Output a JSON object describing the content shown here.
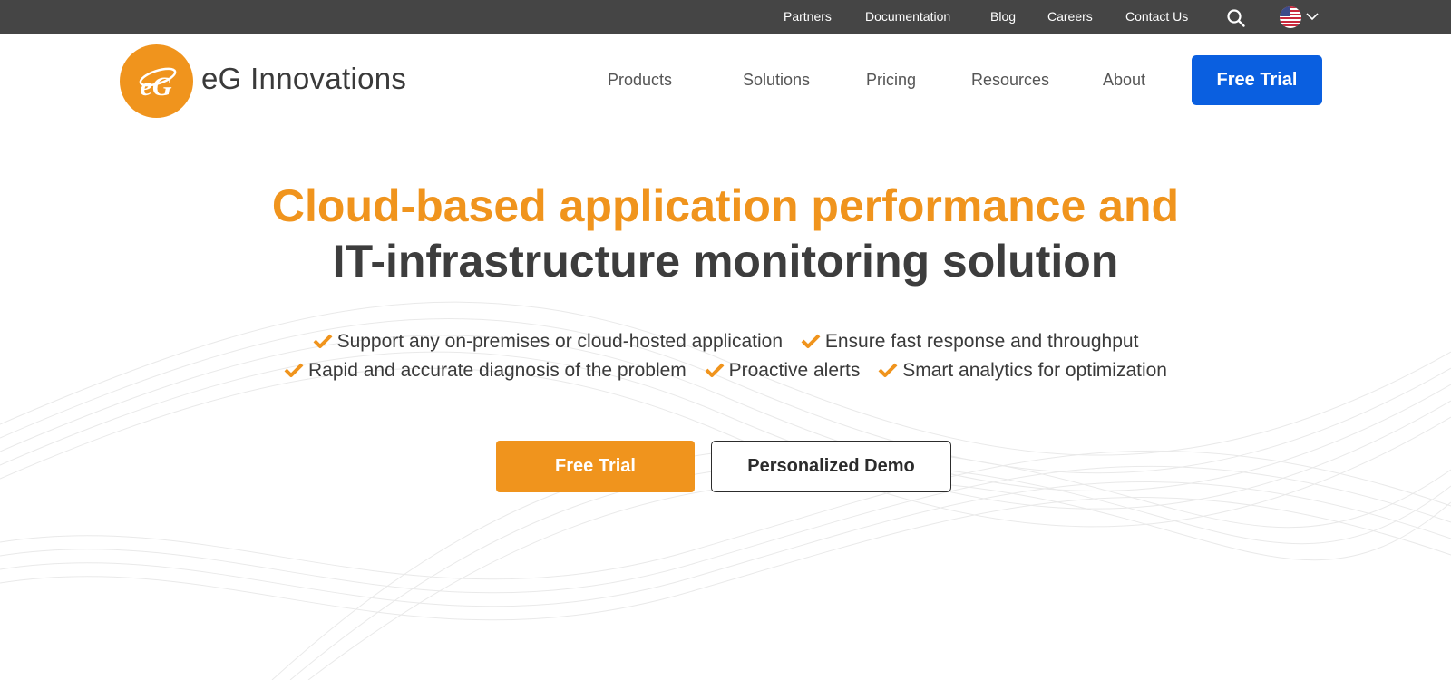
{
  "topbar": {
    "links": [
      "Partners",
      "Documentation",
      "Blog",
      "Careers",
      "Contact Us"
    ],
    "icons": {
      "search": "search-icon",
      "flag": "us-flag-icon",
      "chevron": "chevron-down-icon"
    }
  },
  "header": {
    "logo_text": "eG Innovations",
    "logo_mark": "eG",
    "nav": [
      "Products",
      "Solutions",
      "Pricing",
      "Resources",
      "About"
    ],
    "cta": "Free Trial"
  },
  "hero": {
    "headline_line1": "Cloud-based application performance and",
    "headline_line2": "IT-infrastructure monitoring solution",
    "features_row1": [
      "Support any on-premises or cloud-hosted application",
      "Ensure fast response and throughput"
    ],
    "features_row2": [
      "Rapid and accurate diagnosis of the problem",
      "Proactive alerts",
      "Smart analytics for optimization"
    ],
    "primary_button": "Free Trial",
    "secondary_button": "Personalized Demo"
  },
  "colors": {
    "brand_orange": "#f0941d",
    "brand_blue": "#0a5fe0",
    "topbar_bg": "#454545",
    "headline_dark": "#3d3d3d"
  }
}
